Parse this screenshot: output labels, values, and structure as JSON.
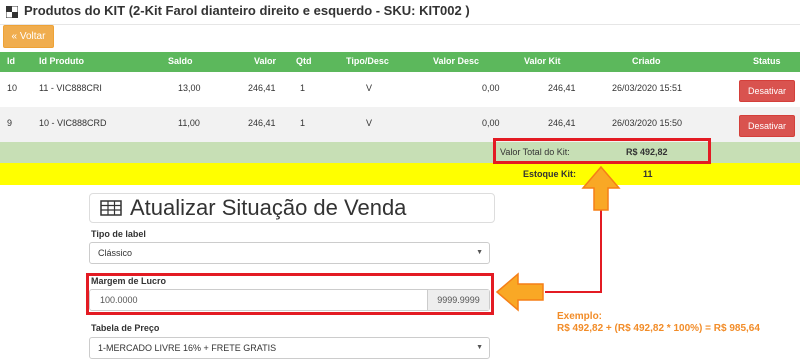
{
  "header": {
    "title": "Produtos do KIT (2-Kit Farol dianteiro direito e esquerdo - SKU: KIT002 )",
    "back_label": "Voltar",
    "back_icon": "double-chevron-left-icon"
  },
  "table": {
    "columns": [
      "Id",
      "Id Produto",
      "Saldo",
      "Valor",
      "Qtd",
      "Tipo/Desc",
      "Valor Desc",
      "Valor Kit",
      "Criado",
      "Status"
    ],
    "rows": [
      {
        "id": "10",
        "id_produto": "11 - VIC888CRI",
        "saldo": "13,00",
        "valor": "246,41",
        "qtd": "1",
        "tipo": "V",
        "valor_desc": "0,00",
        "valor_kit": "246,41",
        "criado": "26/03/2020 15:51",
        "action": "Desativar"
      },
      {
        "id": "9",
        "id_produto": "10 - VIC888CRD",
        "saldo": "11,00",
        "valor": "246,41",
        "qtd": "1",
        "tipo": "V",
        "valor_desc": "0,00",
        "valor_kit": "246,41",
        "criado": "26/03/2020 15:50",
        "action": "Desativar"
      }
    ],
    "total_label": "Valor Total do Kit:",
    "total_value": "R$ 492,82",
    "estoque_label": "Estoque Kit:",
    "estoque_value": "11"
  },
  "form": {
    "panel_title": "Atualizar Situação de Venda",
    "tipo_label": "Tipo de label",
    "tipo_value": "Clássico",
    "margem_label": "Margem de Lucro",
    "margem_value": "100.0000",
    "margem_addon": "9999.9999",
    "tabela_label": "Tabela de Preço",
    "tabela_value": "1-MERCADO LIVRE 16% + FRETE GRATIS"
  },
  "annotation": {
    "line1": "Exemplo:",
    "line2": "R$ 492,82 + (R$ 492,82 * 100%) = R$ 985,64"
  },
  "colors": {
    "header_green": "#5cb85c",
    "total_row": "#c7dfb5",
    "estoque_row": "#ffff00",
    "danger": "#d9534f",
    "warning": "#f0ad4e",
    "highlight_red": "#e31b23",
    "arrow_orange": "#f9a825"
  }
}
